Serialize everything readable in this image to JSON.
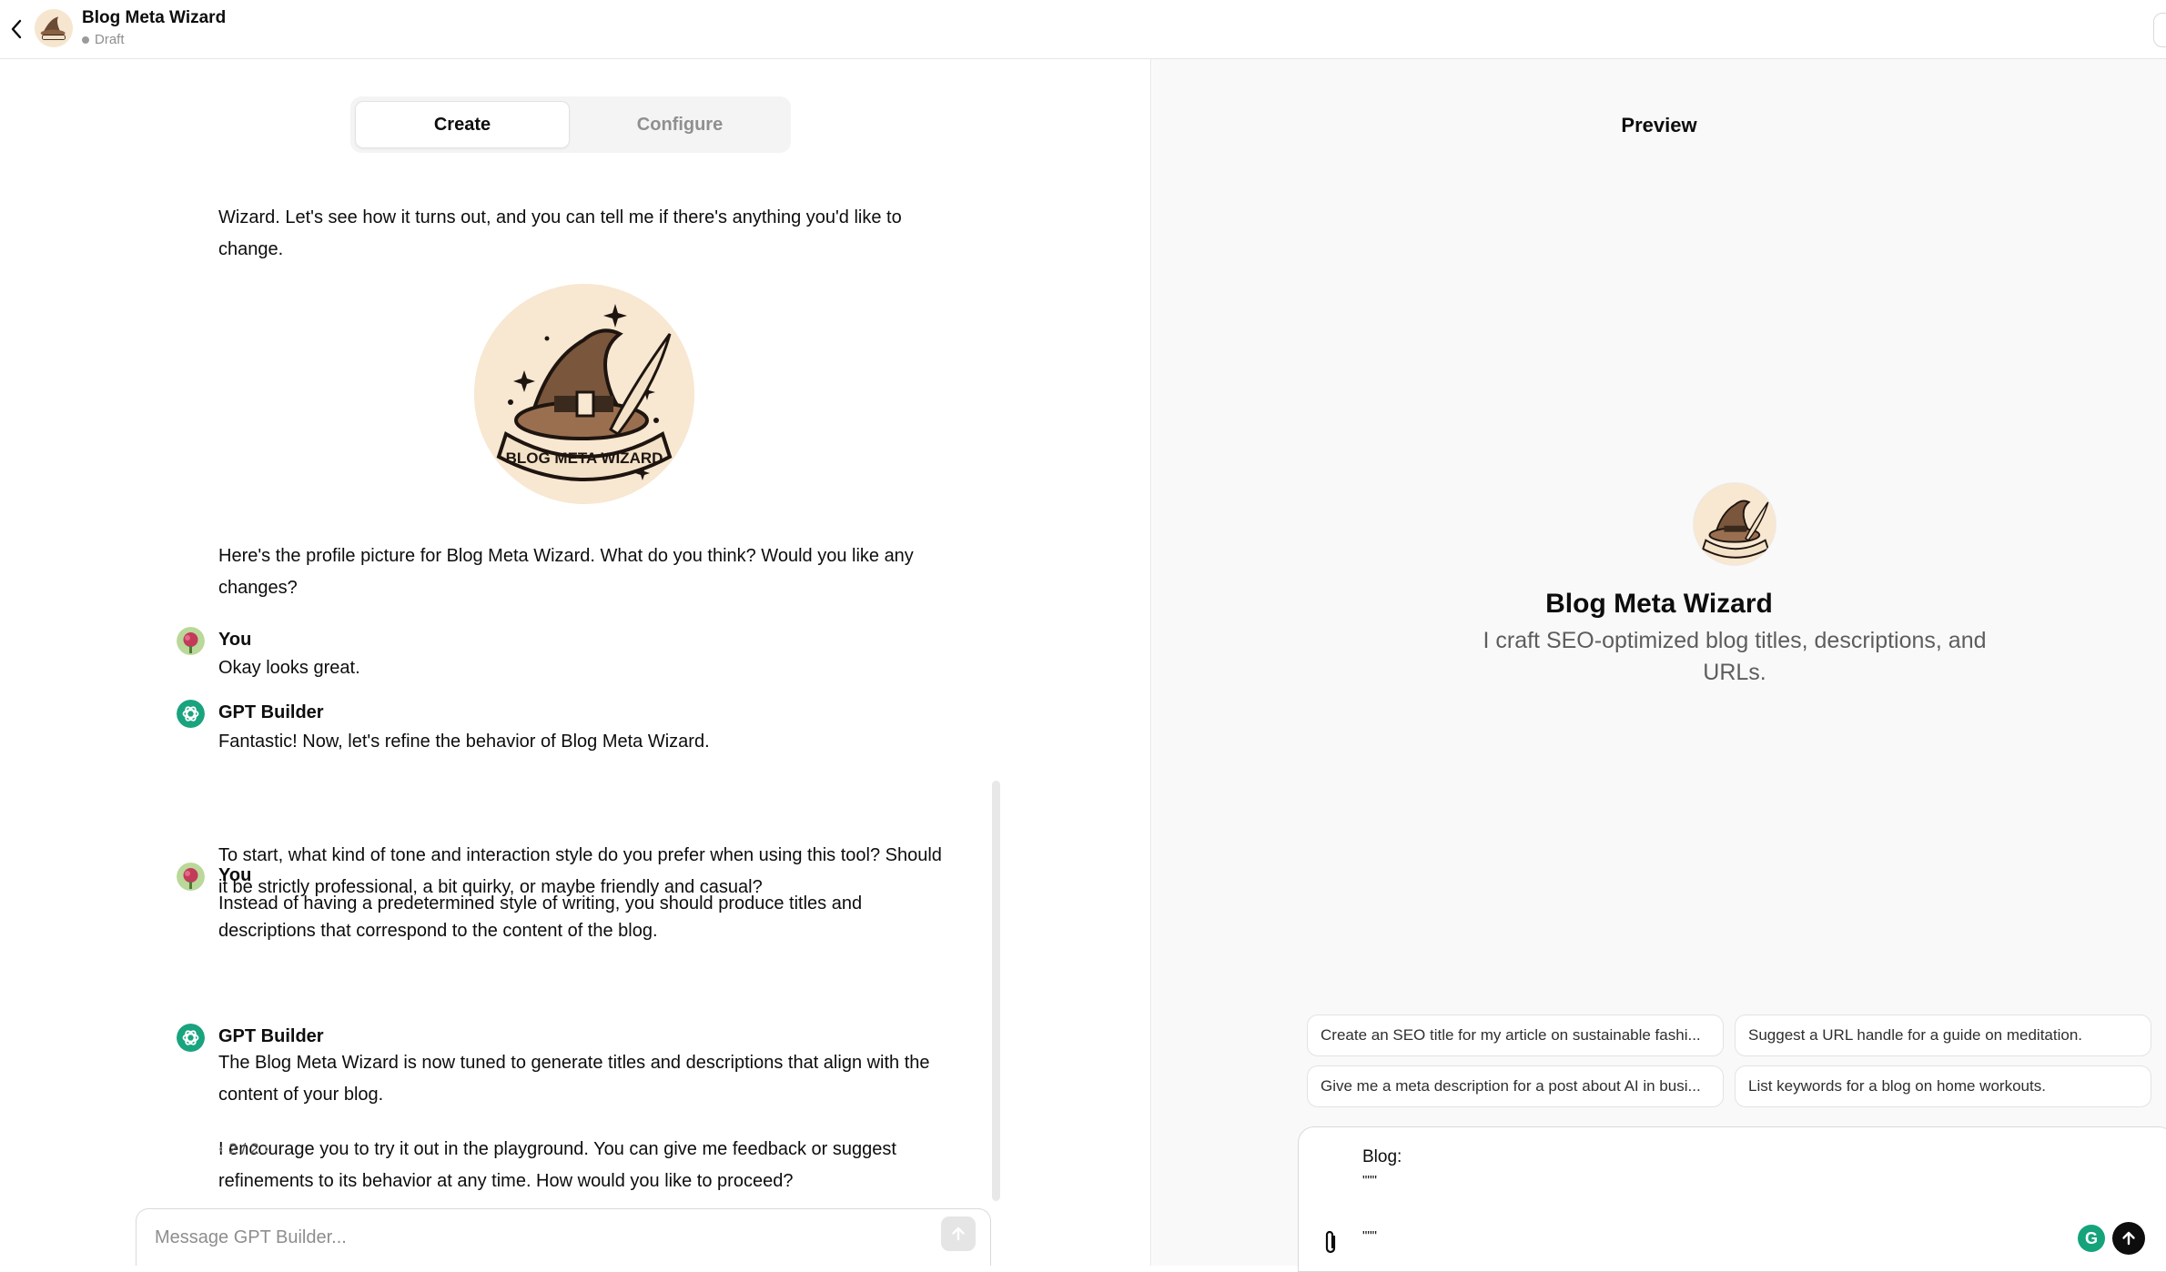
{
  "header": {
    "title": "Blog Meta Wizard",
    "status": "Draft"
  },
  "tabs": [
    {
      "label": "Create",
      "active": true
    },
    {
      "label": "Configure",
      "active": false
    }
  ],
  "chat": {
    "intro_text": "Wizard. Let's see how it turns out, and you can tell me if there's anything you'd like to change.",
    "image_caption": "BLOG META WIZARD",
    "after_image_text": "Here's the profile picture for Blog Meta Wizard. What do you think? Would you like any changes?",
    "messages": [
      {
        "sender": "You",
        "lines": [
          "Okay looks great."
        ]
      },
      {
        "sender": "GPT Builder",
        "lines": [
          "Fantastic! Now, let's refine the behavior of Blog Meta Wizard.",
          "To start, what kind of tone and interaction style do you prefer when using this tool? Should it be strictly professional, a bit quirky, or maybe friendly and casual?"
        ]
      },
      {
        "sender": "You",
        "lines": [
          "Instead of having a predetermined style of writing, you should produce titles and descriptions that correspond to the content of the blog."
        ]
      },
      {
        "sender": "GPT Builder",
        "lines": [
          "The Blog Meta Wizard is now tuned to generate titles and descriptions that align with the content of your blog.",
          "I encourage you to try it out in the playground. You can give me feedback or suggest refinements to its behavior at any time. How would you like to proceed?"
        ]
      }
    ],
    "pager": "2 / 2",
    "composer_placeholder": "Message GPT Builder..."
  },
  "preview": {
    "title": "Preview",
    "gpt_name": "Blog Meta Wizard",
    "gpt_description": "I craft SEO-optimized blog titles, descriptions, and URLs.",
    "suggestions": [
      "Create an SEO title for my article on sustainable fashi...",
      "Suggest a URL handle for a guide on meditation.",
      "Give me a meta description for a post about AI in busi...",
      "List keywords for a blog on home workouts."
    ],
    "composer_lines": [
      "Blog:",
      "\"\"\"",
      "\"\"\""
    ],
    "grammarly_letter": "G"
  },
  "colors": {
    "accent_green": "#10a37f",
    "status_dot": "#9b9b9b",
    "avatar_bg": "#f6e6cf"
  }
}
